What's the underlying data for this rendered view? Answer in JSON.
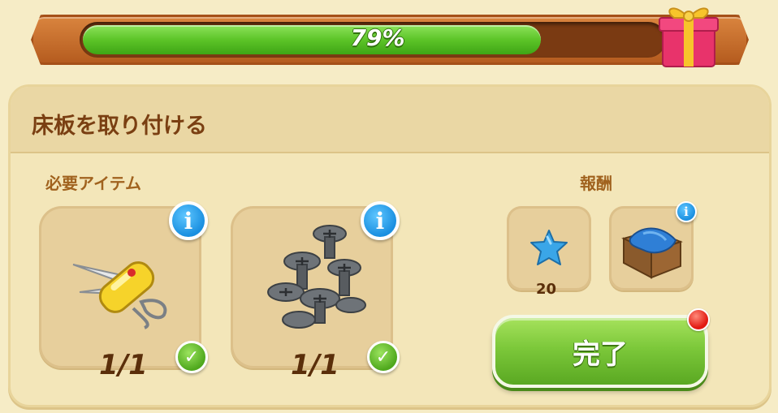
{
  "progress": {
    "percent_label": "79%",
    "value": 0.79
  },
  "task": {
    "title": "床板を取り付ける"
  },
  "required": {
    "label": "必要アイテム",
    "items": [
      {
        "icon": "pocket-knife-icon",
        "count": "1/1",
        "info": "i"
      },
      {
        "icon": "screws-icon",
        "count": "1/1",
        "info": "i"
      }
    ]
  },
  "rewards": {
    "label": "報酬",
    "items": [
      {
        "icon": "blue-star-icon",
        "count": "20"
      },
      {
        "icon": "fabric-crate-icon",
        "info": "i"
      }
    ]
  },
  "complete_button": {
    "label": "完了"
  },
  "colors": {
    "title_brown": "#7a3f12",
    "progress_green": "#5cc428",
    "button_green": "#7cc83a",
    "info_blue": "#1a8fe0",
    "notify_red": "#e21a12"
  }
}
